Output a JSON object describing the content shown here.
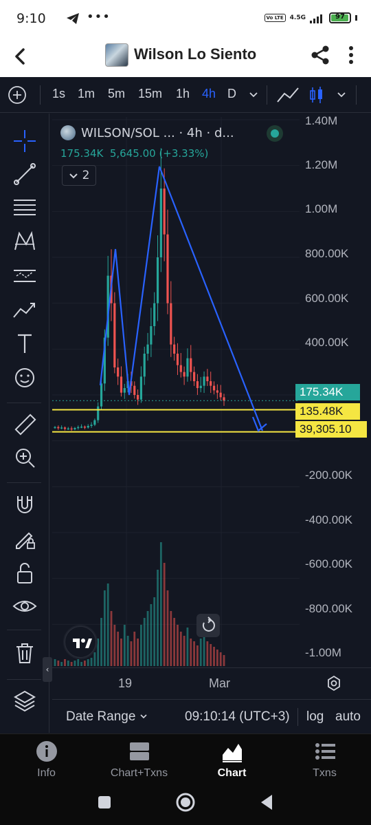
{
  "status_bar": {
    "time": "9:10",
    "network": "4.5G",
    "volte": "Vo LTE",
    "battery": "97"
  },
  "app_header": {
    "title": "Wilson Lo Siento"
  },
  "toolbar": {
    "intervals": [
      "1s",
      "1m",
      "5m",
      "15m",
      "1h",
      "4h",
      "D"
    ],
    "active_interval": "4h"
  },
  "chart": {
    "legend_symbol": "WILSON/SOL ... · 4h · d...",
    "legend_price": "175.34K",
    "legend_change": "5,645.00 (+3.33%)",
    "studies_count": "2",
    "price_axis_labels": [
      "1.40M",
      "1.20M",
      "1.00M",
      "800.00K",
      "600.00K",
      "400.00K",
      "-200.00K",
      "-400.00K",
      "-600.00K",
      "-800.00K",
      "-1.00M"
    ],
    "price_tags": {
      "last": "175.34K",
      "line1": "135.48K",
      "line2": "39,305.10"
    },
    "time_axis_labels": [
      "19",
      "Mar"
    ],
    "colors": {
      "up": "#26a69a",
      "down": "#ef5350",
      "drawing": "#2962ff",
      "hline": "#f5e642",
      "background": "#131722"
    }
  },
  "chart_data": {
    "type": "candlestick",
    "title": "WILSON/SOL",
    "interval": "4h",
    "ylim": [
      -1000000,
      1400000
    ],
    "close_path": [
      60000,
      55000,
      58000,
      52000,
      54000,
      50000,
      56000,
      60000,
      62000,
      58000,
      65000,
      70000,
      90000,
      150000,
      250000,
      450000,
      720000,
      600000,
      320000,
      280000,
      210000,
      230000,
      260000,
      240000,
      200000,
      180000,
      280000,
      380000,
      420000,
      500000,
      600000,
      800000,
      1100000,
      900000,
      600000,
      420000,
      380000,
      330000,
      300000,
      280000,
      360000,
      300000,
      260000,
      230000,
      240000,
      280000,
      260000,
      240000,
      220000,
      210000,
      190000,
      175340
    ],
    "horizontal_lines": [
      135480,
      39305.1
    ],
    "volume_relative": [
      0.05,
      0.04,
      0.03,
      0.05,
      0.04,
      0.03,
      0.04,
      0.05,
      0.03,
      0.04,
      0.05,
      0.06,
      0.1,
      0.2,
      0.35,
      0.55,
      0.6,
      0.4,
      0.3,
      0.25,
      0.2,
      0.3,
      0.22,
      0.18,
      0.25,
      0.2,
      0.3,
      0.35,
      0.4,
      0.45,
      0.5,
      0.7,
      0.9,
      0.75,
      0.55,
      0.4,
      0.35,
      0.3,
      0.25,
      0.22,
      0.28,
      0.2,
      0.18,
      0.15,
      0.2,
      0.22,
      0.18,
      0.16,
      0.14,
      0.12,
      0.1,
      0.08
    ]
  },
  "time_range": {
    "label": "Date Range",
    "clock": "09:10:14 (UTC+3)",
    "log": "log",
    "auto": "auto"
  },
  "bottom_nav": {
    "items": [
      "Info",
      "Chart+Txns",
      "Chart",
      "Txns"
    ],
    "active": "Chart"
  }
}
